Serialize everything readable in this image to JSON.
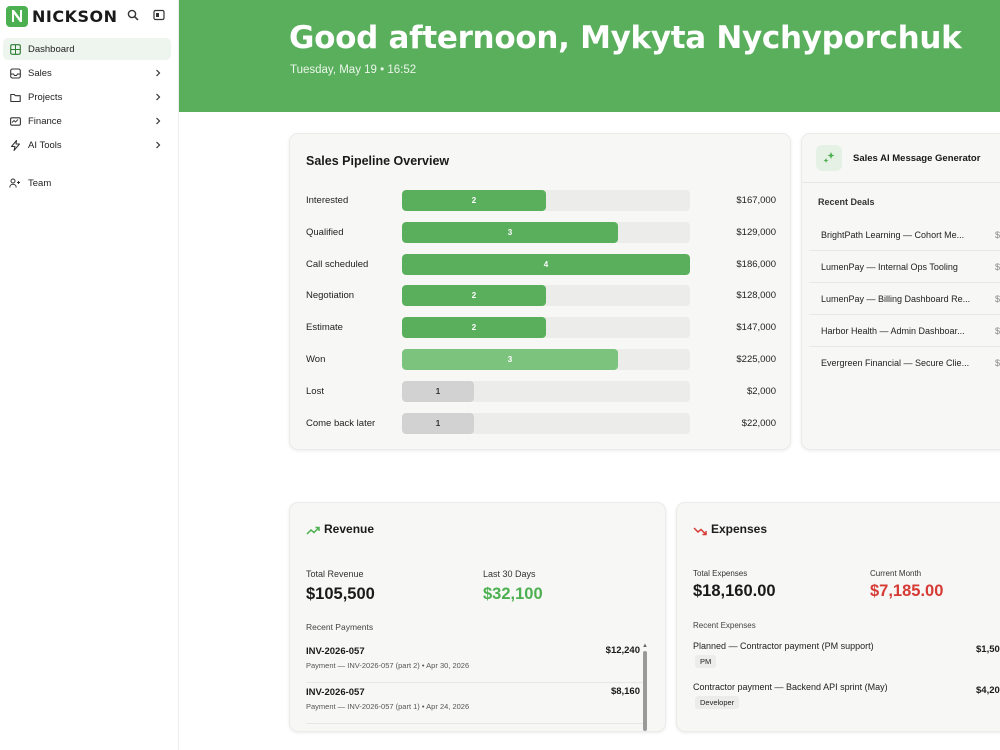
{
  "app": {
    "brand": "NICKSON"
  },
  "sidebar": {
    "items": [
      {
        "label": "Dashboard",
        "icon": "dashboard-icon",
        "active": true
      },
      {
        "label": "Sales",
        "icon": "inbox-icon",
        "chevron": true
      },
      {
        "label": "Projects",
        "icon": "folder-icon",
        "chevron": true
      },
      {
        "label": "Finance",
        "icon": "wallet-icon",
        "chevron": true
      },
      {
        "label": "AI Tools",
        "icon": "bolt-icon",
        "chevron": true
      },
      {
        "label": "Team",
        "icon": "users-icon"
      }
    ]
  },
  "header": {
    "greeting": "Good afternoon, Mykyta Nychyporchuk",
    "datetime": "Tuesday, May 19 • 16:52"
  },
  "pipeline": {
    "title": "Sales Pipeline Overview",
    "max_count": 4,
    "stages": [
      {
        "label": "Interested",
        "count": 2,
        "amount": "$167,000",
        "color": "#5aaf5d"
      },
      {
        "label": "Qualified",
        "count": 3,
        "amount": "$129,000",
        "color": "#5aaf5d"
      },
      {
        "label": "Call scheduled",
        "count": 4,
        "amount": "$186,000",
        "color": "#5aaf5d"
      },
      {
        "label": "Negotiation",
        "count": 2,
        "amount": "$128,000",
        "color": "#5aaf5d"
      },
      {
        "label": "Estimate",
        "count": 2,
        "amount": "$147,000",
        "color": "#5aaf5d"
      },
      {
        "label": "Won",
        "count": 3,
        "amount": "$225,000",
        "color": "#7cc47e"
      },
      {
        "label": "Lost",
        "count": 1,
        "amount": "$2,000",
        "color": "#d2d2d2"
      },
      {
        "label": "Come back later",
        "count": 1,
        "amount": "$22,000",
        "color": "#d2d2d2"
      }
    ]
  },
  "ai_generator": {
    "title": "Sales AI Message Generator",
    "recent_label": "Recent Deals",
    "deals": [
      {
        "name": "BrightPath Learning — Cohort Me...",
        "amount": "$"
      },
      {
        "name": "LumenPay — Internal Ops Tooling",
        "amount": "$"
      },
      {
        "name": "LumenPay — Billing Dashboard Re...",
        "amount": "$"
      },
      {
        "name": "Harbor Health — Admin Dashboar...",
        "amount": "$"
      },
      {
        "name": "Evergreen Financial — Secure Clie...",
        "amount": "$"
      }
    ]
  },
  "revenue": {
    "title": "Revenue",
    "total_label": "Total Revenue",
    "total_value": "$105,500",
    "last30_label": "Last 30 Days",
    "last30_value": "$32,100",
    "recent_label": "Recent Payments",
    "payments": [
      {
        "id": "INV-2026-057",
        "desc": "Payment — INV-2026-057 (part 2) • Apr 30, 2026",
        "amount": "$12,240"
      },
      {
        "id": "INV-2026-057",
        "desc": "Payment — INV-2026-057 (part 1) • Apr 24, 2026",
        "amount": "$8,160"
      }
    ]
  },
  "expenses": {
    "title": "Expenses",
    "total_label": "Total Expenses",
    "total_value": "$18,160.00",
    "month_label": "Current Month",
    "month_value": "$7,185.00",
    "recent_label": "Recent Expenses",
    "items": [
      {
        "name": "Planned — Contractor payment (PM support)",
        "tag": "PM",
        "amount": "$1,50"
      },
      {
        "name": "Contractor payment — Backend API sprint (May)",
        "tag": "Developer",
        "amount": "$4,20"
      }
    ]
  },
  "colors": {
    "accent": "#5aaf5d",
    "negative": "#d63c35"
  }
}
